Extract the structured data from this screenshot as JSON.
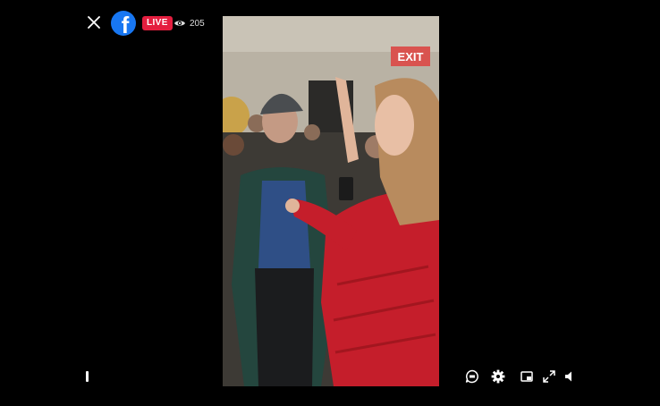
{
  "header": {
    "brand_icon": "facebook-logo-icon",
    "brand_letter": "f",
    "live_label": "LIVE",
    "viewer_count": "205"
  },
  "video": {
    "exit_sign": "EXIT"
  },
  "colors": {
    "facebook_blue": "#1877f2",
    "live_red": "#e41e3f",
    "background": "#000000"
  },
  "controls": {
    "icons": [
      "captions-icon",
      "settings-icon",
      "picture-in-picture-icon",
      "fullscreen-icon",
      "volume-icon"
    ]
  }
}
